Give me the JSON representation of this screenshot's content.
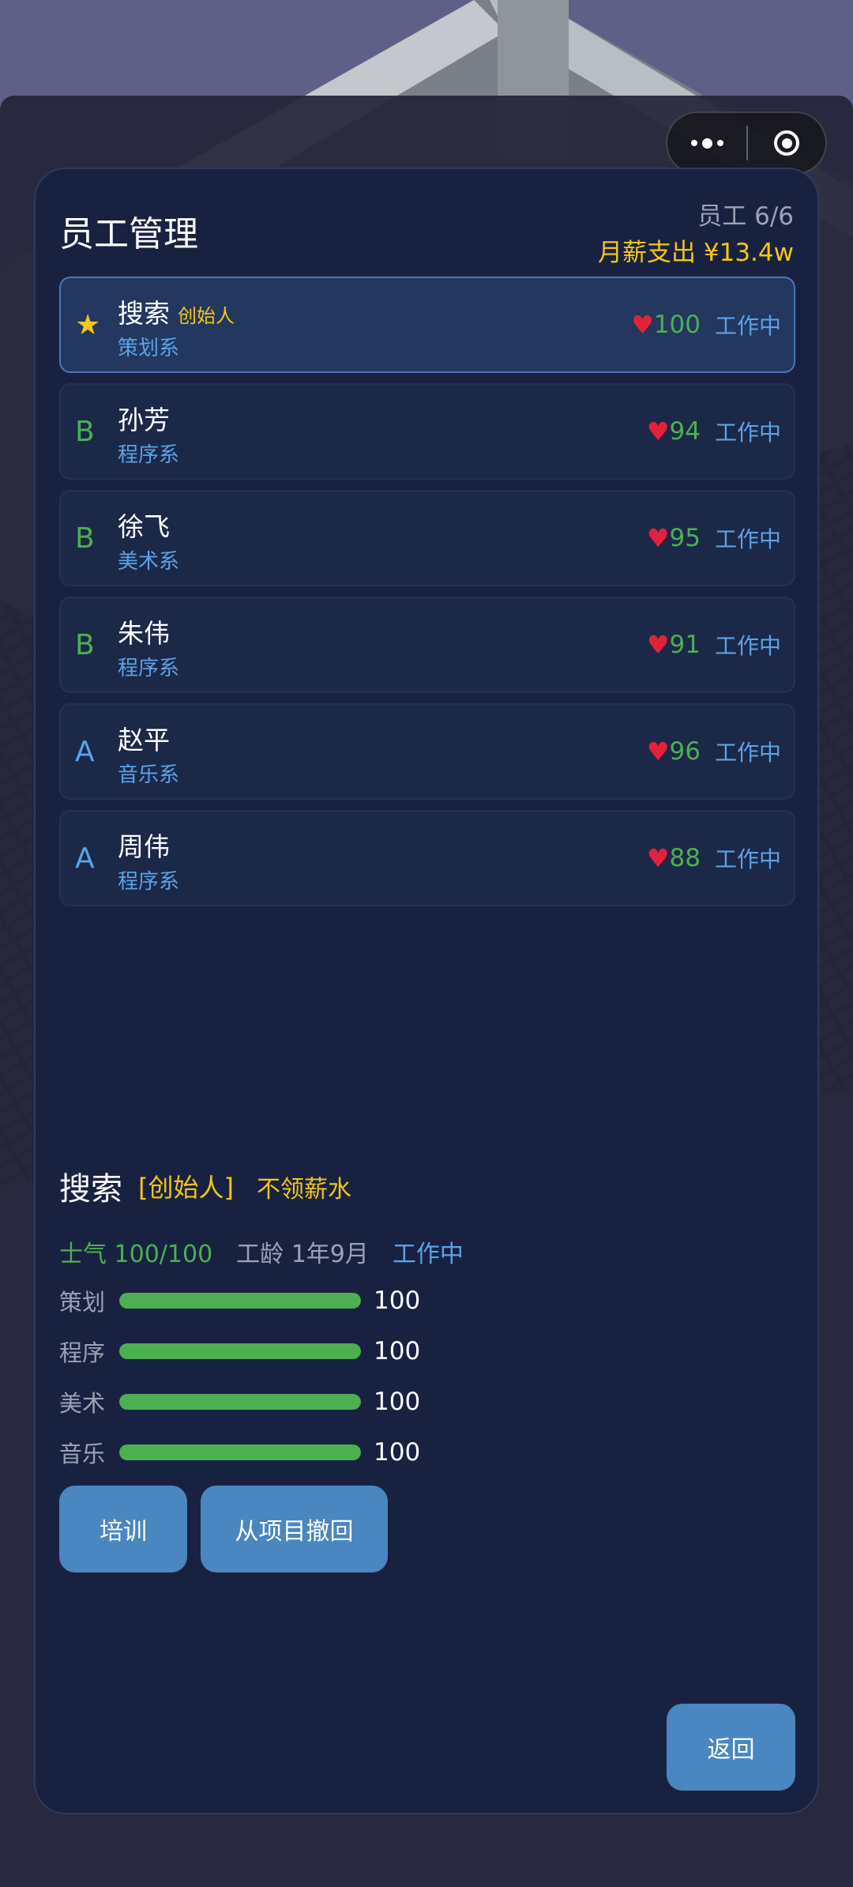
{
  "header": {
    "title": "员工管理",
    "count": "员工 6/6",
    "payroll": "月薪支出 ¥13.4w"
  },
  "colors": {
    "gold": "#f5c518",
    "green": "#4cb050",
    "blue": "#5aa3e8",
    "heart": "#e0223a",
    "button": "#4a86bf",
    "panel": "#182240"
  },
  "employees": [
    {
      "grade": "★",
      "grade_color": "#f5c518",
      "name": "搜索",
      "tag": "创始人",
      "dept": "策划系",
      "heart": "♥",
      "mood": "100",
      "mood_color": "#4cb050",
      "status": "工作中",
      "selected": true
    },
    {
      "grade": "B",
      "grade_color": "#4cb050",
      "name": "孙芳",
      "tag": "",
      "dept": "程序系",
      "heart": "♥",
      "mood": "94",
      "mood_color": "#4cb050",
      "status": "工作中",
      "selected": false
    },
    {
      "grade": "B",
      "grade_color": "#4cb050",
      "name": "徐飞",
      "tag": "",
      "dept": "美术系",
      "heart": "♥",
      "mood": "95",
      "mood_color": "#4cb050",
      "status": "工作中",
      "selected": false
    },
    {
      "grade": "B",
      "grade_color": "#4cb050",
      "name": "朱伟",
      "tag": "",
      "dept": "程序系",
      "heart": "♥",
      "mood": "91",
      "mood_color": "#4cb050",
      "status": "工作中",
      "selected": false
    },
    {
      "grade": "A",
      "grade_color": "#5aa3e8",
      "name": "赵平",
      "tag": "",
      "dept": "音乐系",
      "heart": "♥",
      "mood": "96",
      "mood_color": "#4cb050",
      "status": "工作中",
      "selected": false
    },
    {
      "grade": "A",
      "grade_color": "#5aa3e8",
      "name": "周伟",
      "tag": "",
      "dept": "程序系",
      "heart": "♥",
      "mood": "88",
      "mood_color": "#4cb050",
      "status": "工作中",
      "selected": false
    }
  ],
  "detail": {
    "name": "搜索",
    "role": "[创始人]",
    "note": "不领薪水",
    "morale": "士气 100/100",
    "tenure": "工龄 1年9月",
    "status": "工作中",
    "skills": [
      {
        "label": "策划",
        "value": "100",
        "max": 100
      },
      {
        "label": "程序",
        "value": "100",
        "max": 100
      },
      {
        "label": "美术",
        "value": "100",
        "max": 100
      },
      {
        "label": "音乐",
        "value": "100",
        "max": 100
      }
    ]
  },
  "buttons": {
    "train": "培训",
    "withdraw": "从项目撤回",
    "back": "返回"
  },
  "capsule": {
    "more_icon": "more-dots-icon",
    "close_icon": "target-close-icon"
  }
}
